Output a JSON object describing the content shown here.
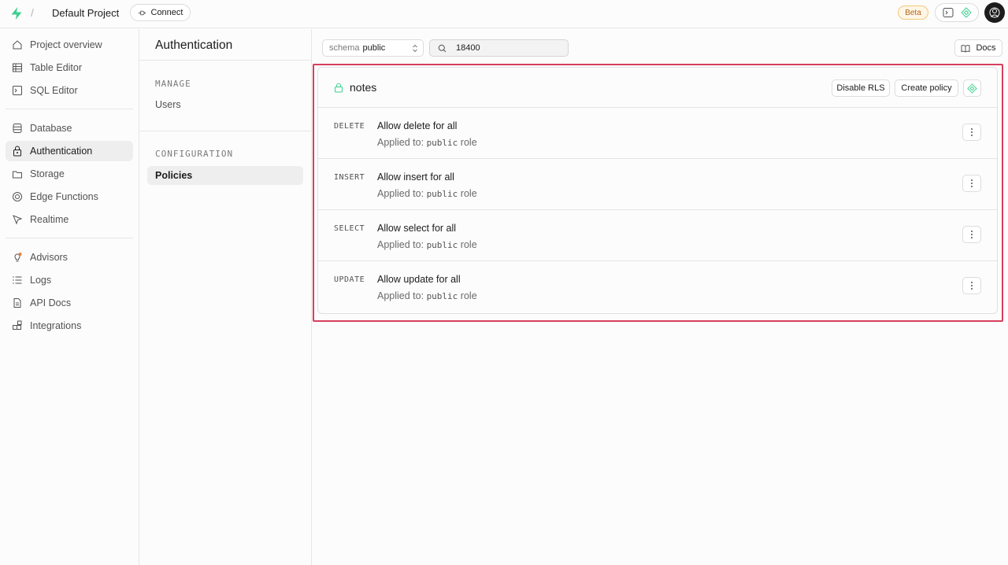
{
  "topbar": {
    "project_name": "Default Project",
    "separator": "/",
    "connect_label": "Connect",
    "beta_label": "Beta"
  },
  "leftnav": {
    "items": [
      {
        "label": "Project overview",
        "icon": "home-icon"
      },
      {
        "label": "Table Editor",
        "icon": "table-icon"
      },
      {
        "label": "SQL Editor",
        "icon": "terminal-icon"
      },
      {
        "label": "Database",
        "icon": "database-icon"
      },
      {
        "label": "Authentication",
        "icon": "auth-icon",
        "active": true
      },
      {
        "label": "Storage",
        "icon": "storage-icon"
      },
      {
        "label": "Edge Functions",
        "icon": "edge-functions-icon"
      },
      {
        "label": "Realtime",
        "icon": "realtime-icon"
      },
      {
        "label": "Advisors",
        "icon": "lightbulb-icon"
      },
      {
        "label": "Logs",
        "icon": "list-icon"
      },
      {
        "label": "API Docs",
        "icon": "file-icon"
      },
      {
        "label": "Integrations",
        "icon": "integrations-icon"
      }
    ]
  },
  "submenu": {
    "title": "Authentication",
    "section_manage": "MANAGE",
    "users_label": "Users",
    "section_config": "CONFIGURATION",
    "policies_label": "Policies"
  },
  "toolbar": {
    "schema_label": "schema",
    "schema_value": "public",
    "search_value": "18400",
    "docs_label": "Docs"
  },
  "table": {
    "name": "notes",
    "disable_rls_label": "Disable RLS",
    "create_policy_label": "Create policy",
    "applied_prefix": "Applied to:",
    "role_suffix": "role",
    "policies": [
      {
        "command": "DELETE",
        "name": "Allow delete for all",
        "role": "public"
      },
      {
        "command": "INSERT",
        "name": "Allow insert for all",
        "role": "public"
      },
      {
        "command": "SELECT",
        "name": "Allow select for all",
        "role": "public"
      },
      {
        "command": "UPDATE",
        "name": "Allow update for all",
        "role": "public"
      }
    ]
  },
  "colors": {
    "brand_green": "#3ecf8e",
    "highlight_red": "#d6405e",
    "beta_orange": "#b5631a"
  }
}
